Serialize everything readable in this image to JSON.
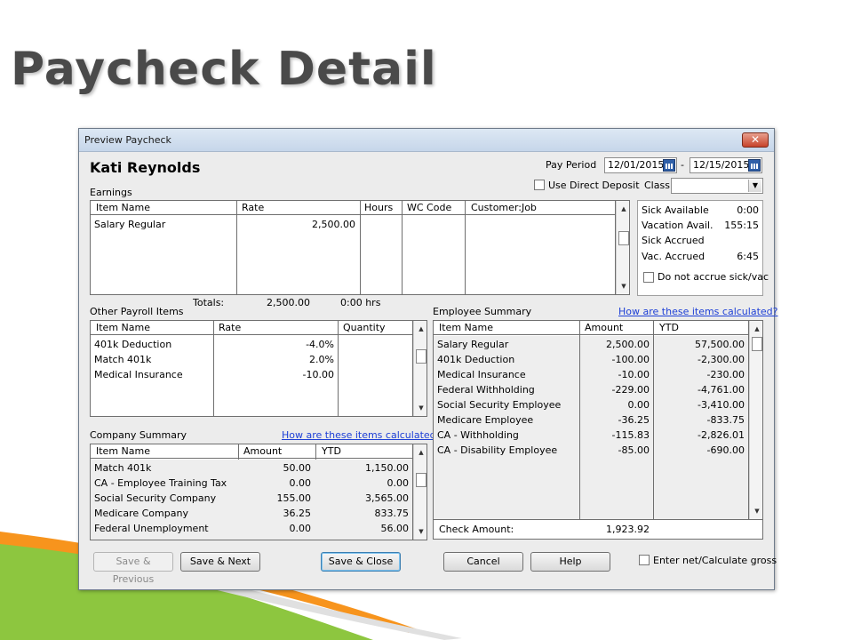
{
  "slide_title": "Paycheck Detail",
  "window": {
    "title": "Preview Paycheck",
    "close_glyph": "✕"
  },
  "employee_name": "Kati Reynolds",
  "pay_period": {
    "label": "Pay Period",
    "from": "12/01/2015",
    "separator": "-",
    "to": "12/15/2015"
  },
  "direct_deposit_label": "Use Direct Deposit",
  "class_label": "Class",
  "class_value": "",
  "earnings": {
    "section_label": "Earnings",
    "headers": [
      "Item Name",
      "Rate",
      "Hours",
      "WC Code",
      "Customer:Job"
    ],
    "rows": [
      {
        "item": "Salary Regular",
        "rate": "2,500.00",
        "hours": "",
        "wc": "",
        "job": ""
      }
    ],
    "totals_label": "Totals:",
    "totals_amount": "2,500.00",
    "totals_hours": "0:00 hrs"
  },
  "sick_vac": {
    "rows": [
      {
        "label": "Sick Available",
        "value": "0:00"
      },
      {
        "label": "Vacation Avail.",
        "value": "155:15"
      },
      {
        "label": "Sick Accrued",
        "value": ""
      },
      {
        "label": "Vac. Accrued",
        "value": "6:45"
      }
    ],
    "no_accrue_label": "Do not accrue sick/vac"
  },
  "other_payroll": {
    "section_label": "Other Payroll Items",
    "headers": [
      "Item Name",
      "Rate",
      "Quantity"
    ],
    "rows": [
      {
        "item": "401k Deduction",
        "rate": "-4.0%",
        "qty": ""
      },
      {
        "item": "Match 401k",
        "rate": "2.0%",
        "qty": ""
      },
      {
        "item": "Medical Insurance",
        "rate": "-10.00",
        "qty": ""
      }
    ]
  },
  "company_summary": {
    "section_label": "Company Summary",
    "link": "How are these items calculated?",
    "headers": [
      "Item Name",
      "Amount",
      "YTD"
    ],
    "rows": [
      {
        "item": "Match 401k",
        "amount": "50.00",
        "ytd": "1,150.00"
      },
      {
        "item": "CA - Employee Training Tax",
        "amount": "0.00",
        "ytd": "0.00"
      },
      {
        "item": "Social Security Company",
        "amount": "155.00",
        "ytd": "3,565.00"
      },
      {
        "item": "Medicare Company",
        "amount": "36.25",
        "ytd": "833.75"
      },
      {
        "item": "Federal Unemployment",
        "amount": "0.00",
        "ytd": "56.00"
      }
    ]
  },
  "employee_summary": {
    "section_label": "Employee Summary",
    "link": "How are these items calculated?",
    "headers": [
      "Item Name",
      "Amount",
      "YTD"
    ],
    "rows": [
      {
        "item": "Salary Regular",
        "amount": "2,500.00",
        "ytd": "57,500.00"
      },
      {
        "item": "401k Deduction",
        "amount": "-100.00",
        "ytd": "-2,300.00"
      },
      {
        "item": "Medical Insurance",
        "amount": "-10.00",
        "ytd": "-230.00"
      },
      {
        "item": "Federal Withholding",
        "amount": "-229.00",
        "ytd": "-4,761.00"
      },
      {
        "item": "Social Security Employee",
        "amount": "0.00",
        "ytd": "-3,410.00"
      },
      {
        "item": "Medicare Employee",
        "amount": "-36.25",
        "ytd": "-833.75"
      },
      {
        "item": "CA - Withholding",
        "amount": "-115.83",
        "ytd": "-2,826.01"
      },
      {
        "item": "CA - Disability Employee",
        "amount": "-85.00",
        "ytd": "-690.00"
      }
    ],
    "check_amount_label": "Check Amount:",
    "check_amount": "1,923.92"
  },
  "buttons": {
    "save_previous": "Save & Previous",
    "save_next": "Save & Next",
    "save_close": "Save & Close",
    "cancel": "Cancel",
    "help": "Help"
  },
  "enter_net_label": "Enter net/Calculate gross",
  "colors": {
    "link": "#1d3fd6",
    "deco_green": "#8dc63f",
    "deco_orange": "#f7941d"
  }
}
